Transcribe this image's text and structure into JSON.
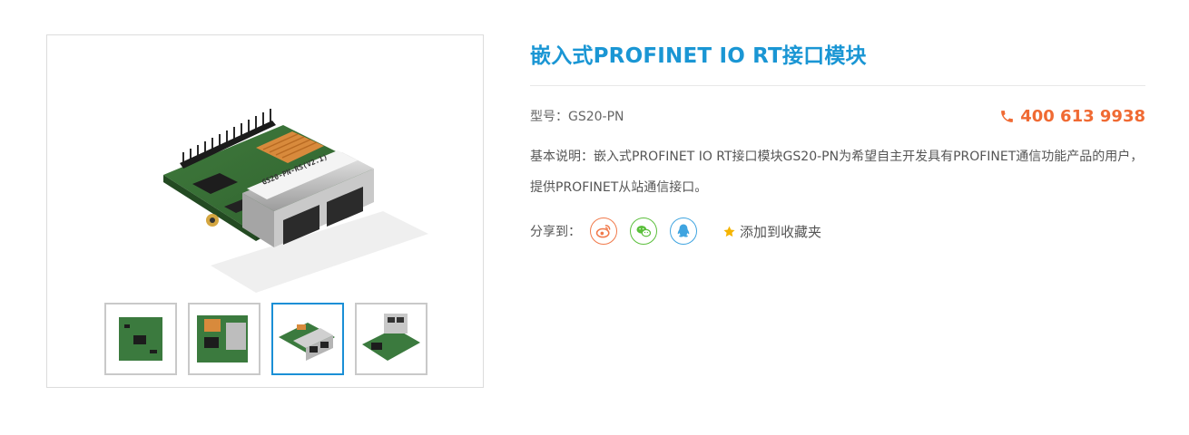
{
  "product": {
    "title": "嵌入式PROFINET IO RT接口模块",
    "model_label": "型号：",
    "model_value": "GS20-PN",
    "phone": "400 613 9938",
    "description": "基本说明：嵌入式PROFINET IO RT接口模块GS20-PN为希望自主开发具有PROFINET通信功能产品的用户，提供PROFINET从站通信接口。"
  },
  "module_label": {
    "connector_label": "GS20-PN-RS(V2.1)"
  },
  "share": {
    "label": "分享到：",
    "icons": [
      "weibo-icon",
      "wechat-icon",
      "qq-icon"
    ],
    "favorite_label": "添加到收藏夹"
  },
  "gallery": {
    "thumbnails": [
      "board-top",
      "board-angle",
      "board-ports",
      "board-side"
    ],
    "active_thumbnail": 2
  },
  "colors": {
    "accent_blue": "#1a96d4",
    "phone_orange": "#f06a33",
    "star_yellow": "#f5b400",
    "weibo_orange": "#f1794a",
    "wechat_green": "#5bbf3c",
    "qq_blue": "#3fa4e0"
  }
}
